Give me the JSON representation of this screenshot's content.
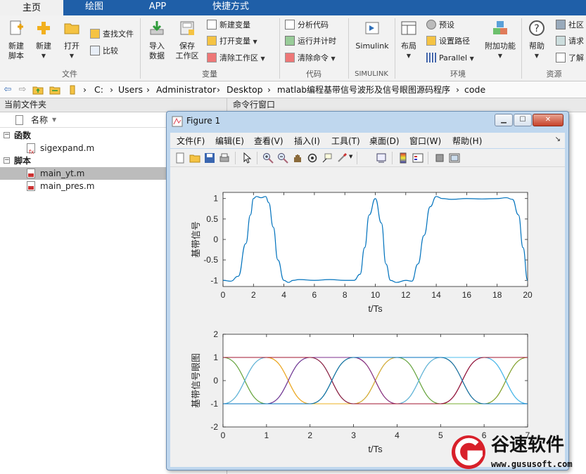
{
  "tabs": [
    "主页",
    "绘图",
    "APP",
    "快捷方式"
  ],
  "ribbon": {
    "new_script": "新建\n脚本",
    "new": "新建",
    "open": "打开",
    "find_files": "查找文件",
    "compare": "比较",
    "import_data": "导入\n数据",
    "save_workspace": "保存\n工作区",
    "new_variable": "新建变量",
    "open_variable": "打开变量",
    "clear_workspace": "清除工作区",
    "analyze_code": "分析代码",
    "run_and_time": "运行并计时",
    "clear_commands": "清除命令",
    "simulink": "Simulink",
    "layout": "布局",
    "preferences": "预设",
    "set_path": "设置路径",
    "parallel": "Parallel",
    "addons": "附加功能",
    "help": "帮助",
    "community": "社区",
    "request_support": "请求",
    "learn": "了解",
    "sections": [
      "文件",
      "变量",
      "代码",
      "SIMULINK",
      "环境",
      "资源"
    ]
  },
  "address": [
    "C:",
    "Users",
    "Administrator",
    "Desktop",
    "matlab编程基带信号波形及信号眼图源码程序",
    "code"
  ],
  "file_panel": {
    "title": "当前文件夹",
    "col_name": "名称",
    "groups": [
      {
        "label": "函数",
        "files": [
          "sigexpand.m"
        ]
      },
      {
        "label": "脚本",
        "files": [
          "main_yt.m",
          "main_pres.m"
        ]
      }
    ]
  },
  "cmd_panel": {
    "title": "命令行窗口"
  },
  "figure": {
    "title": "Figure 1",
    "menus": [
      "文件(F)",
      "编辑(E)",
      "查看(V)",
      "插入(I)",
      "工具(T)",
      "桌面(D)",
      "窗口(W)",
      "帮助(H)"
    ]
  },
  "watermark": {
    "text": "谷速软件",
    "url": "www.gususoft.com"
  },
  "chart_data": [
    {
      "type": "line",
      "ylabel": "基带信号",
      "xlabel": "t/Ts",
      "xlim": [
        0,
        20
      ],
      "ylim": [
        -1.15,
        1.15
      ],
      "xticks": [
        0,
        2,
        4,
        6,
        8,
        10,
        12,
        14,
        16,
        18,
        20
      ],
      "yticks": [
        -1,
        -0.5,
        0,
        0.5,
        1
      ],
      "color": "#0072bd",
      "series": [
        {
          "x": [
            0,
            0.5,
            1,
            1.5,
            1.8,
            2,
            2.2,
            2.5,
            2.8,
            3,
            3.3,
            3.6,
            4,
            4.3,
            4.6,
            5,
            6,
            7,
            8,
            8.6,
            9,
            9.3,
            9.6,
            10,
            10.4,
            10.7,
            11,
            11.4,
            12,
            12.4,
            12.8,
            13.2,
            13.6,
            14,
            14.4,
            15,
            16,
            17,
            18,
            18.6,
            19,
            19.4,
            19.7,
            20
          ],
          "values": [
            -1,
            -1.02,
            -0.9,
            -0.1,
            0.6,
            1,
            1.05,
            1.02,
            1.05,
            0.9,
            0.3,
            -0.5,
            -1,
            -1.05,
            -1,
            -0.98,
            -1,
            -0.98,
            -1,
            -1,
            -0.85,
            -0.2,
            0.6,
            1,
            0.4,
            -0.6,
            -1,
            -1.05,
            -1,
            -1.02,
            -0.6,
            0.1,
            0.8,
            1.05,
            1,
            0.98,
            1,
            0.99,
            1,
            1.02,
            0.98,
            0.6,
            -0.2,
            -1
          ]
        }
      ]
    },
    {
      "type": "line",
      "ylabel": "基带信号眼图",
      "xlabel": "t/Ts",
      "xlim": [
        0,
        7
      ],
      "ylim": [
        -2,
        2
      ],
      "xticks": [
        0,
        1,
        2,
        3,
        4,
        5,
        6,
        7
      ],
      "yticks": [
        -2,
        -1,
        0,
        1,
        2
      ],
      "series": [
        {
          "color": "#0072bd",
          "values": [
            1,
            -1,
            1,
            -1,
            1,
            -1,
            1,
            -1
          ]
        },
        {
          "color": "#d95319",
          "values": [
            -1,
            1,
            -1,
            1,
            -1,
            1,
            -1,
            1
          ]
        },
        {
          "color": "#edb120",
          "values": [
            1,
            1,
            -1,
            -1,
            1,
            1,
            -1,
            -1
          ]
        },
        {
          "color": "#7e2f8e",
          "values": [
            -1,
            -1,
            1,
            1,
            -1,
            -1,
            1,
            1
          ]
        },
        {
          "color": "#77ac30",
          "values": [
            1,
            -1,
            -1,
            1,
            1,
            -1,
            -1,
            1
          ]
        },
        {
          "color": "#4dbeee",
          "values": [
            -1,
            1,
            1,
            -1,
            -1,
            1,
            1,
            -1
          ]
        },
        {
          "color": "#a2142f",
          "values": [
            1,
            1,
            1,
            -1,
            -1,
            -1,
            1,
            1
          ]
        },
        {
          "color": "#0072bd",
          "values": [
            -1,
            -1,
            -1,
            1,
            1,
            1,
            -1,
            -1
          ]
        }
      ]
    }
  ]
}
